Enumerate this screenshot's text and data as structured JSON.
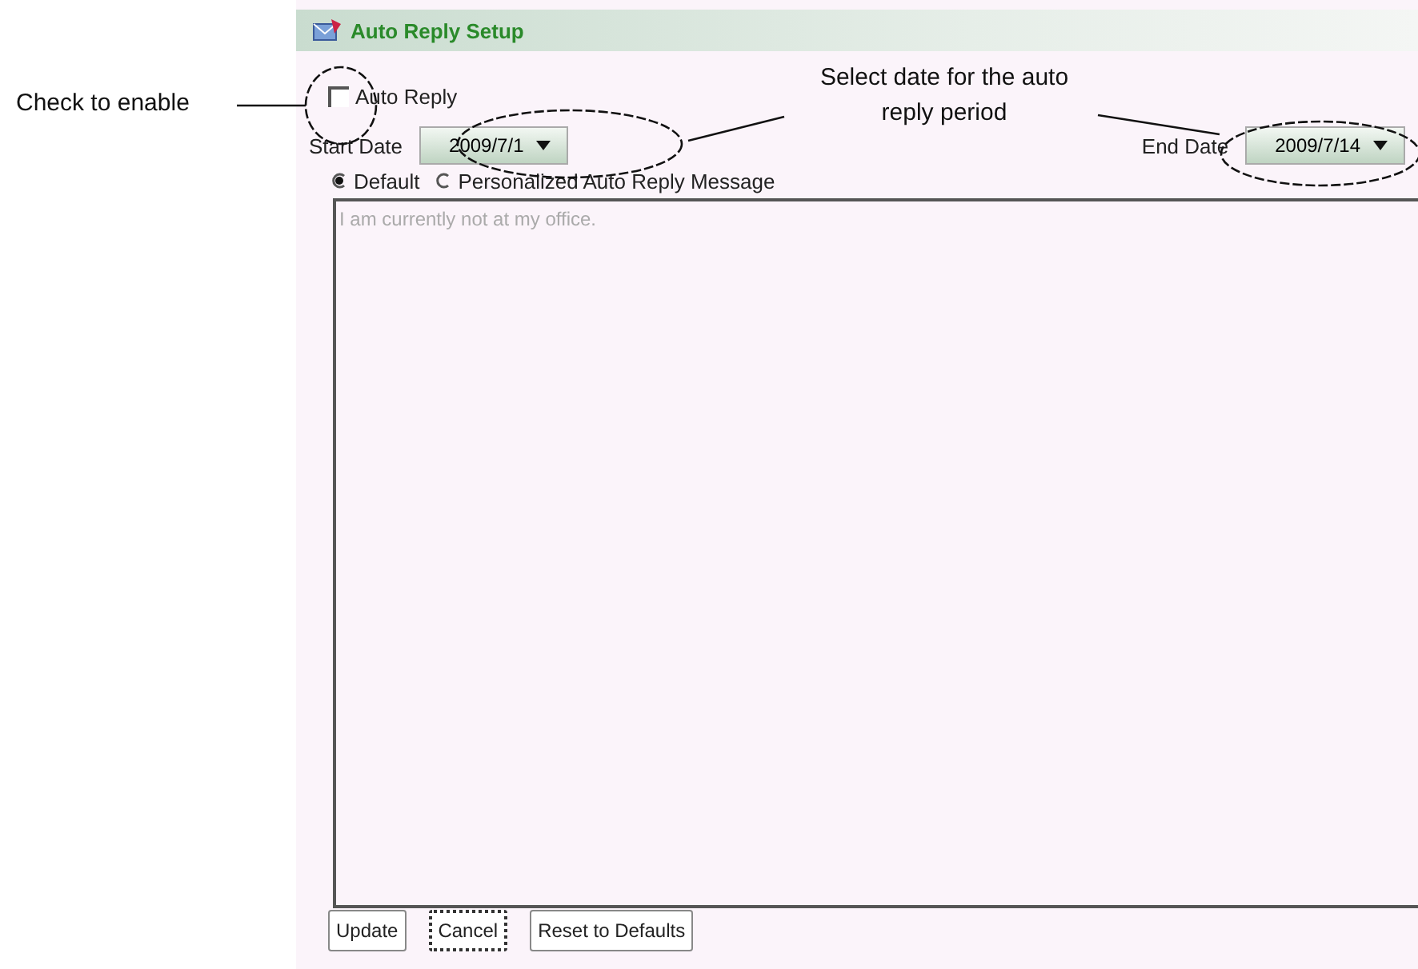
{
  "annotations": [
    {
      "text": "Check to enable"
    },
    {
      "text": "Select date for the auto reply period"
    }
  ],
  "window": {
    "title": "Auto Reply Setup"
  },
  "auto_reply": {
    "label": "Auto Reply",
    "checked": false
  },
  "start_date": {
    "label": "Start Date",
    "value": "2009/7/1"
  },
  "end_date": {
    "label": "End Date",
    "value": "2009/7/14"
  },
  "message_type": [
    {
      "label": "Default",
      "selected": true
    },
    {
      "label": "Personalized Auto Reply Message",
      "selected": false
    }
  ],
  "message": {
    "placeholder": "I am currently not at my office."
  },
  "buttons": [
    {
      "label": "Update",
      "focused": false
    },
    {
      "label": "Cancel",
      "focused": true
    },
    {
      "label": "Reset to Defaults",
      "focused": false
    }
  ]
}
